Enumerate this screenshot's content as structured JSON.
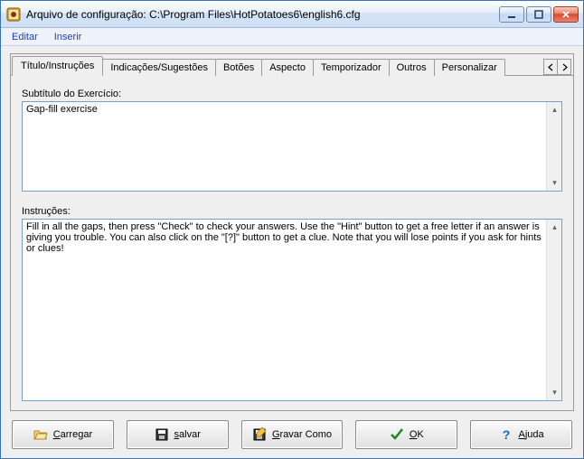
{
  "window": {
    "title": "Arquivo de configuração: C:\\Program Files\\HotPotatoes6\\english6.cfg"
  },
  "menu": {
    "edit": "Editar",
    "insert": "Inserir"
  },
  "tabs": {
    "titulo": "Título/Instruções",
    "indicacoes": "Indicações/Sugestões",
    "botoes": "Botões",
    "aspecto": "Aspecto",
    "temporizador": "Temporizador",
    "outros": "Outros",
    "personalizar": "Personalizar"
  },
  "labels": {
    "subtitle": "Subtítulo do Exercício:",
    "instructions": "Instruções:"
  },
  "values": {
    "subtitle": "Gap-fill exercise",
    "instructions": "Fill in all the gaps, then press \"Check\" to check your answers. Use the \"Hint\" button to get a free letter if an answer is giving you trouble. You can also click on the \"[?]\" button to get a clue. Note that you will lose points if you ask for hints or clues!"
  },
  "buttons": {
    "load": "Carregar",
    "save": "salvar",
    "saveas": "Gravar Como",
    "ok": "OK",
    "help": "Ajuda"
  }
}
